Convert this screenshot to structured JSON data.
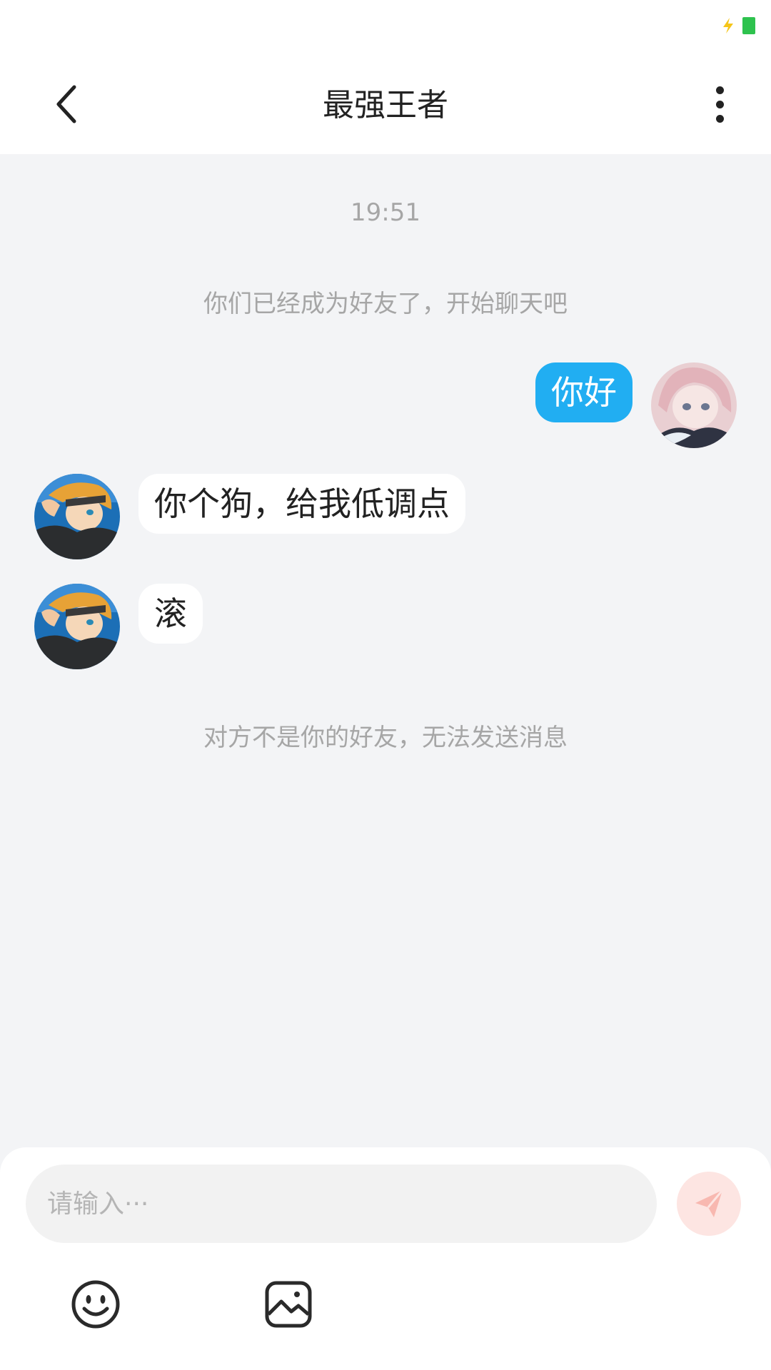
{
  "header": {
    "title": "最强王者",
    "back_icon": "chevron-left-icon",
    "more_icon": "more-vertical-icon"
  },
  "status_bar": {
    "icons": [
      "charging-icon",
      "battery-icon"
    ]
  },
  "chat": {
    "time": "19:51",
    "friend_notice": "你们已经成为好友了，开始聊天吧",
    "messages": [
      {
        "side": "outgoing",
        "text": "你好"
      },
      {
        "side": "incoming",
        "text": "你个狗，给我低调点"
      },
      {
        "side": "incoming",
        "text": "滚"
      }
    ],
    "blocked_notice": "对方不是你的好友，无法发送消息"
  },
  "composer": {
    "placeholder": "请输入···",
    "send_icon": "paper-plane-icon",
    "tools": [
      "emoji-icon",
      "image-icon"
    ]
  },
  "colors": {
    "outgoing_bubble": "#21aef2",
    "incoming_bubble": "#ffffff",
    "chat_background": "#f3f4f6",
    "send_button": "#fde5e2",
    "send_icon": "#f8b8b0"
  }
}
